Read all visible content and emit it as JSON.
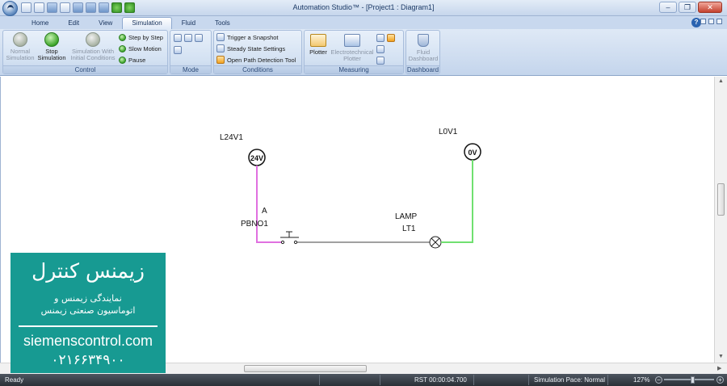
{
  "window": {
    "title": "Automation Studio™ - [Project1 : Diagram1]",
    "controls": {
      "minimize": "–",
      "restore": "❐",
      "close": "✕"
    }
  },
  "ribbon_tabs": [
    "Home",
    "Edit",
    "View",
    "Simulation",
    "Fluid",
    "Tools"
  ],
  "active_tab": "Simulation",
  "help": "?",
  "groups": {
    "control": {
      "label": "Control",
      "normal_simulation": [
        "Normal",
        "Simulation"
      ],
      "stop_simulation": [
        "Stop",
        "Simulation"
      ],
      "simulation_with_ic": [
        "Simulation With",
        "Initial Conditions"
      ],
      "step_by_step": "Step by Step",
      "slow_motion": "Slow Motion",
      "pause": "Pause"
    },
    "mode": {
      "label": "Mode"
    },
    "conditions": {
      "label": "Conditions",
      "trigger_snapshot": "Trigger a Snapshot",
      "steady_state": "Steady State Settings",
      "open_path": "Open Path Detection Tool"
    },
    "measuring": {
      "label": "Measuring",
      "plotter": "Plotter",
      "electrotechnical_plotter": [
        "Electrotechnical",
        "Plotter"
      ]
    },
    "dashboard": {
      "label": "Dashboard",
      "fluid_dashboard": [
        "Fluid",
        "Dashboard"
      ]
    }
  },
  "diagram": {
    "source_label": "L24V1",
    "source_value": "24V",
    "ground_label": "L0V1",
    "ground_value": "0V",
    "switch_terminal": "A",
    "switch_label": "PBNO1",
    "lamp_type": "LAMP",
    "lamp_label": "LT1",
    "colors": {
      "energized_wire": "#e070e0",
      "ground_wire": "#70e070",
      "idle_wire": "#404040"
    }
  },
  "statusbar": {
    "ready": "Ready",
    "rst_time": "RST 00:00:04.700",
    "simulation_pace": "Simulation Pace: Normal",
    "zoom": "127%"
  },
  "watermark": {
    "title": "زیمنس کنترل",
    "line1": "نمایندگی زیمنس و",
    "line2": "اتوماسیون صنعتی زیمنس",
    "website": "siemenscontrol.com",
    "phone": "۰۲۱۶۶۳۴۹۰۰"
  }
}
